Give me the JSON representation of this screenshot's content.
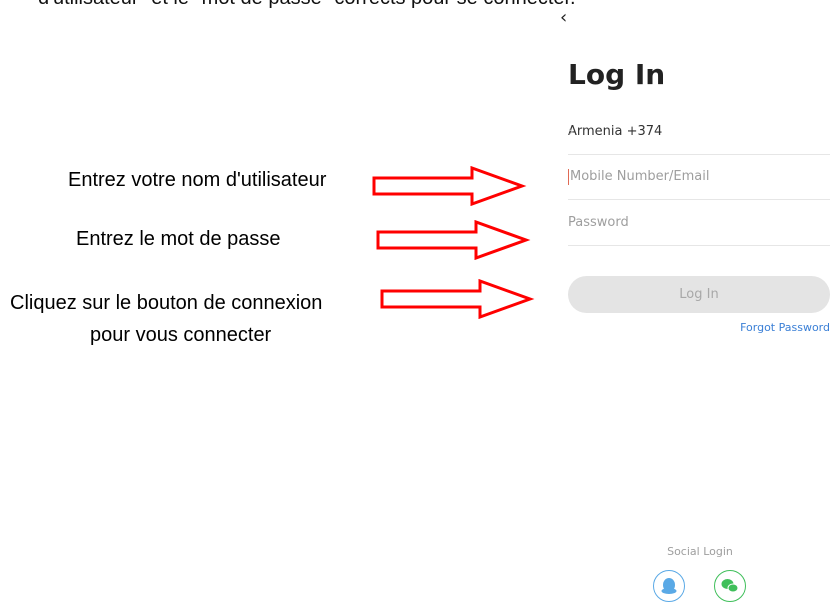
{
  "top_caption": "d'utilisateur\" et le \"mot de passe\" corrects pour se connecter.",
  "annotations": {
    "username": "Entrez votre nom d'utilisateur",
    "password": "Entrez le mot de passe",
    "login_line1": "Cliquez sur le bouton de connexion",
    "login_line2": "pour vous connecter"
  },
  "login": {
    "back_icon": "chevron-left-icon",
    "title": "Log In",
    "country": "Armenia +374",
    "username_placeholder": "Mobile Number/Email",
    "password_placeholder": "Password",
    "button_label": "Log In",
    "forgot_label": "Forgot Password",
    "social_label": "Social Login",
    "social_icons": [
      "qq-icon",
      "wechat-icon"
    ]
  },
  "colors": {
    "arrow": "#ff0000",
    "link": "#3a7fd6",
    "qq": "#5aa9e6",
    "wechat": "#3fbf5a"
  }
}
